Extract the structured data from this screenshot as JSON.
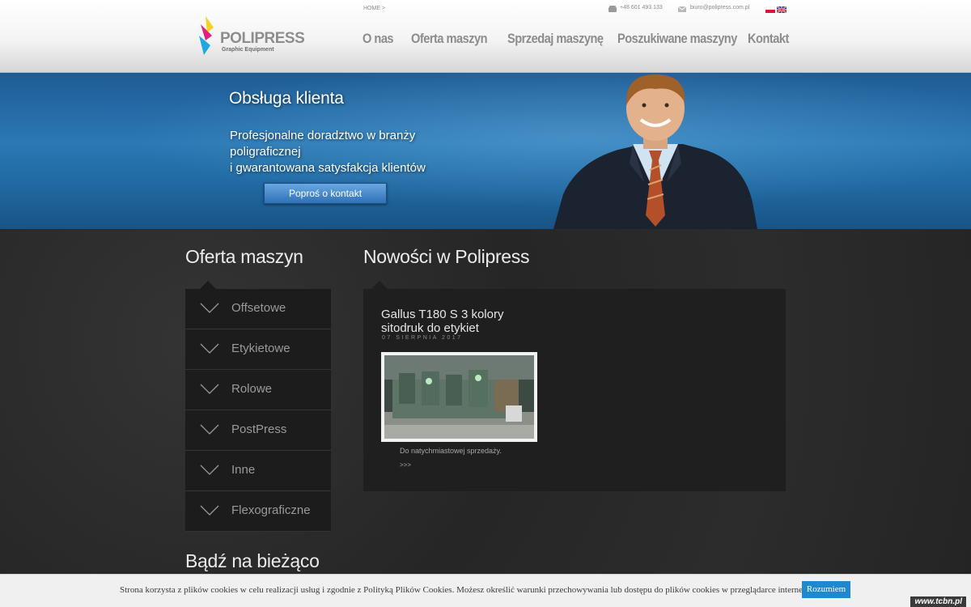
{
  "header": {
    "logo_name": "POLIPRESS",
    "logo_tagline": "Graphic Equipment",
    "breadcrumb": "HOME >",
    "phone": "+48 601 493 133",
    "email": "biuro@polipress.com.pl",
    "nav": [
      "O nas",
      "Oferta maszyn",
      "Sprzedaj maszynę",
      "Poszukiwane maszyny",
      "Kontakt"
    ]
  },
  "hero": {
    "title": "Obsługa klienta",
    "text_line1": "Profesjonalne doradztwo w branży",
    "text_line2": "poligraficznej",
    "text_line3": "i gwarantowana satysfakcja klientów",
    "button": "Poproś o kontakt"
  },
  "sidebar": {
    "title": "Oferta maszyn",
    "items": [
      "Offsetowe",
      "Etykietowe",
      "Rolowe",
      "PostPress",
      "Inne",
      "Flexograficzne"
    ],
    "next_title": "Bądź na bieżąco"
  },
  "news": {
    "title": "Nowości w Polipress",
    "item": {
      "title_line1": "Gallus T180 S 3 kolory",
      "title_line2": "sitodruk do etykiet",
      "date": "07 SIERPNIA 2017",
      "desc": "Do natychmiastowej sprzedaży.",
      "more": ">>>"
    }
  },
  "cookie": {
    "text": "Strona korzysta z plików cookies w celu realizacji usług i zgodnie z Polityką Plików Cookies. Możesz określić warunki przechowywania lub dostępu do plików cookies w przeglądarce internetowej",
    "button": "Rozumiem"
  },
  "credit": "www.tcbn.pl",
  "colors": {
    "hero_blue": "#2b78b4",
    "dark_bg": "#2a2a2a",
    "cookie_button": "#1f89cf"
  }
}
